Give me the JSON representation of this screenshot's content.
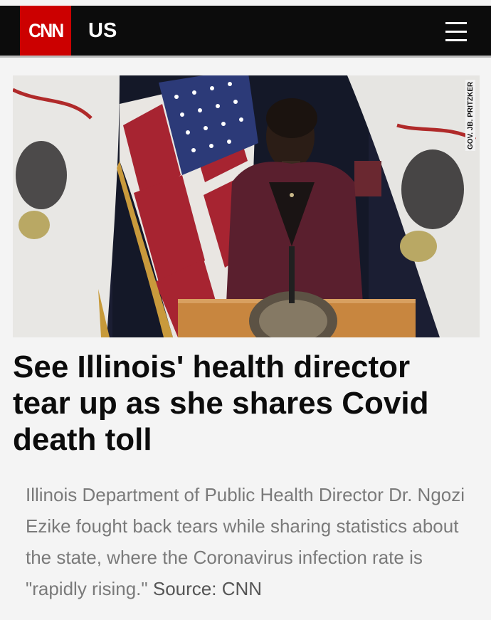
{
  "header": {
    "logo_text": "CNN",
    "section": "US",
    "menu_icon": "hamburger-menu-icon",
    "brand_color": "#cc0000",
    "bar_color": "#0c0c0c"
  },
  "hero_image": {
    "watermark": "GOV. JB. PRITZKER"
  },
  "article": {
    "headline": "See Illinois' health director tear up as she shares Covid death toll",
    "summary": "Illinois Department of Public Health Director Dr. Ngozi Ezike fought back tears while sharing statistics about the state, where the Coronavirus infection rate is \"rapidly rising.\"",
    "source": "Source: CNN"
  }
}
